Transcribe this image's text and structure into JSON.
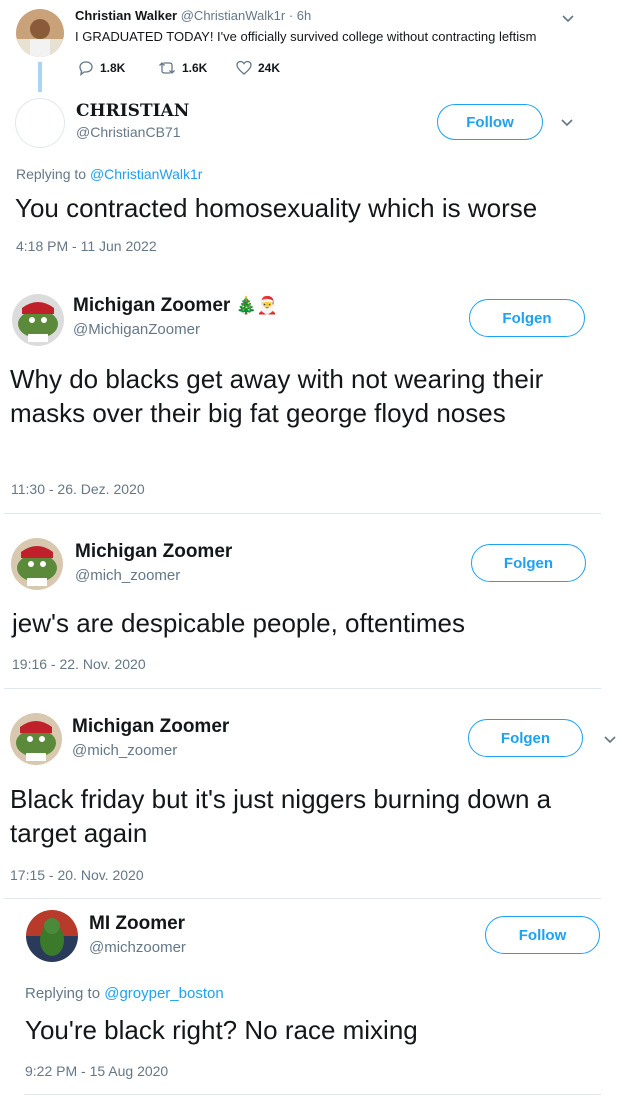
{
  "tweet1": {
    "name": "Christian Walker",
    "handle": "@ChristianWalk1r",
    "sep": "·",
    "time": "6h",
    "text": "I GRADUATED TODAY! I've officially survived college without contracting leftism",
    "replies": "1.8K",
    "retweets": "1.6K",
    "likes": "24K"
  },
  "tweet2": {
    "name": "CHRISTIAN",
    "handle": "@ChristianCB71",
    "follow": "Follow",
    "replying_prefix": "Replying to",
    "replying_to": "@ChristianWalk1r",
    "text": "You contracted homosexuality which is worse",
    "timestamp": "4:18 PM - 11 Jun 2022"
  },
  "tweet3": {
    "name": "Michigan Zoomer",
    "emoji": "🎄🎅",
    "handle": "@MichiganZoomer",
    "follow": "Folgen",
    "text": "Why do blacks get away with not wearing their masks over their big fat george floyd noses",
    "timestamp": "11:30 - 26. Dez. 2020"
  },
  "tweet4": {
    "name": "Michigan Zoomer",
    "handle": "@mich_zoomer",
    "follow": "Folgen",
    "text": "jew's are despicable people, oftentimes",
    "timestamp": "19:16 - 22. Nov. 2020"
  },
  "tweet5": {
    "name": "Michigan Zoomer",
    "handle": "@mich_zoomer",
    "follow": "Folgen",
    "text": "Black friday but it's just niggers burning down a target again",
    "timestamp": "17:15 - 20. Nov. 2020"
  },
  "tweet6": {
    "name": "MI Zoomer",
    "handle": "@michzoomer",
    "follow": "Follow",
    "replying_prefix": "Replying to",
    "replying_to": "@groyper_boston",
    "text": "You're black right? No race mixing",
    "timestamp": "9:22 PM - 15 Aug 2020"
  },
  "colors": {
    "accent": "#1da1f2",
    "secondary_text": "#657786",
    "divider": "#e1e8ed"
  }
}
